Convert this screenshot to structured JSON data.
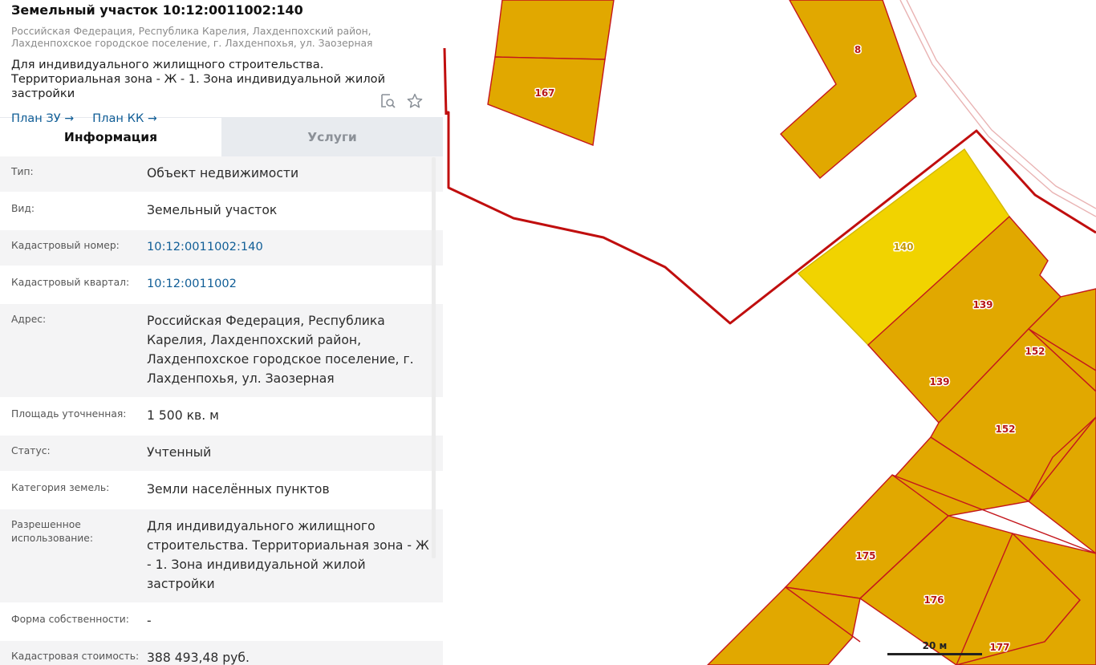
{
  "header": {
    "title": "Земельный участок 10:12:0011002:140",
    "address": "Российская Федерация, Республика Карелия, Лахденпохский район, Лахденпохское городское поселение, г. Лахденпохья, ул. Заозерная",
    "usage": "Для индивидуального жилищного строительства. Территориальная зона - Ж - 1. Зона индивидуальной жилой застройки",
    "links": [
      {
        "label": "План ЗУ",
        "arrow": "→"
      },
      {
        "label": "План КК",
        "arrow": "→"
      }
    ],
    "icons": [
      "search-document-icon",
      "star-icon"
    ]
  },
  "tabs": [
    {
      "label": "Информация",
      "active": true
    },
    {
      "label": "Услуги",
      "active": false
    }
  ],
  "rows": [
    {
      "label": "Тип:",
      "value": "Объект недвижимости"
    },
    {
      "label": "Вид:",
      "value": "Земельный участок"
    },
    {
      "label": "Кадастровый номер:",
      "value": "10:12:0011002:140",
      "link": true
    },
    {
      "label": "Кадастровый квартал:",
      "value": "10:12:0011002",
      "link": true
    },
    {
      "label": "Адрес:",
      "value": "Российская Федерация, Республика Карелия, Лахденпохский район, Лахденпохское городское поселение, г. Лахденпохья, ул. Заозерная"
    },
    {
      "label": "Площадь уточненная:",
      "value": "1 500 кв. м"
    },
    {
      "label": "Статус:",
      "value": "Учтенный"
    },
    {
      "label": "Категория земель:",
      "value": "Земли населённых пунктов"
    },
    {
      "label": "Разрешенное использование:",
      "value": "Для индивидуального жилищного строительства. Территориальная зона - Ж - 1. Зона индивидуальной жилой застройки"
    },
    {
      "label": "Форма собственности:",
      "value": "-"
    },
    {
      "label": "Кадастровая стоимость:",
      "value": "388 493,48 руб."
    }
  ],
  "map": {
    "plot_labels": [
      {
        "id": "plot-167",
        "text": "167"
      },
      {
        "id": "plot-8",
        "text": "8"
      },
      {
        "id": "plot-140",
        "text": "140",
        "selected": true
      },
      {
        "id": "plot-139-a",
        "text": "139"
      },
      {
        "id": "plot-139-b",
        "text": "139"
      },
      {
        "id": "plot-152-a",
        "text": "152"
      },
      {
        "id": "plot-152-b",
        "text": "152"
      },
      {
        "id": "plot-175",
        "text": "175"
      },
      {
        "id": "plot-176",
        "text": "176"
      },
      {
        "id": "plot-177",
        "text": "177"
      }
    ],
    "scale_label": "20 м",
    "colors": {
      "plot_fill": "#e1a800",
      "plot_stroke": "#c4161c",
      "selected_fill": "#f1d300",
      "quarter_border": "#c00e0e"
    }
  }
}
